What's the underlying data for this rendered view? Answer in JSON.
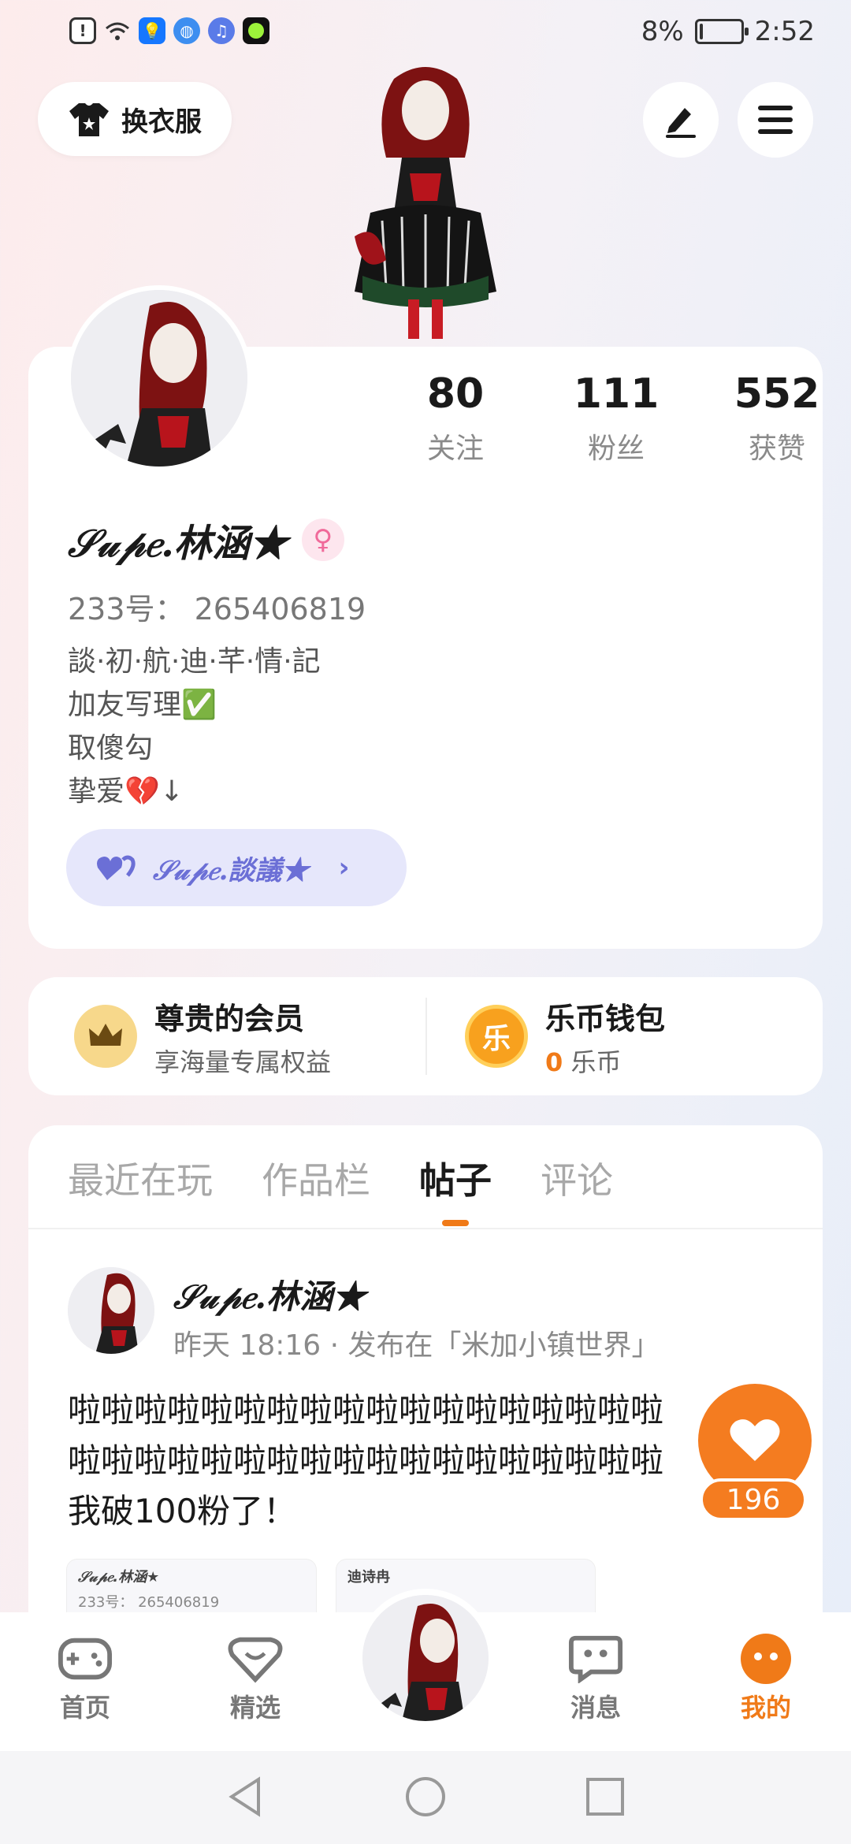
{
  "status_bar": {
    "battery": "8%",
    "battery_level": 0.08,
    "time": "2:52",
    "icons": [
      "alert-icon",
      "wifi-icon",
      "bulb-app-icon",
      "globe-app-icon",
      "music-app-icon",
      "green-app-icon"
    ]
  },
  "header": {
    "outfit_label": "换衣服",
    "edit_icon": "pen-icon",
    "menu_icon": "hamburger-icon"
  },
  "profile": {
    "stats": [
      {
        "value": "80",
        "label": "关注"
      },
      {
        "value": "111",
        "label": "粉丝"
      },
      {
        "value": "552",
        "label": "获赞"
      }
    ],
    "username": "𝒮𝓊𝓅𝑒.林涵★",
    "gender_symbol": "♀",
    "uid": "233号：  265406819",
    "bio": [
      "談·初·航·迪·芊·情·記",
      "加友写理✅",
      "取傻勾",
      "挚爱💔↓"
    ],
    "tag_label": "𝒮𝓊𝓅𝑒.談議★",
    "tag_chevron": "›"
  },
  "member": {
    "vip_title": "尊贵的会员",
    "vip_sub": "享海量专属权益",
    "wallet_title": "乐币钱包",
    "wallet_icon_text": "乐",
    "coin_value": "0",
    "coin_unit": "乐币"
  },
  "tabs": {
    "items": [
      "最近在玩",
      "作品栏",
      "帖子",
      "评论"
    ],
    "active_index": 2
  },
  "post": {
    "author": "𝒮𝓊𝓅𝑒.林涵★",
    "meta": "昨天 18:16 · 发布在「米加小镇世界」",
    "lines": [
      "啦啦啦啦啦啦啦啦啦啦啦啦啦啦啦啦啦啦",
      "啦啦啦啦啦啦啦啦啦啦啦啦啦啦啦啦啦啦",
      "我破100粉了！"
    ],
    "thumb1_name": "𝒮𝓊𝓅𝑒.林涵★",
    "thumb1_id": "233号：  265406819",
    "thumb2_name": "迪诗冉",
    "like_count": "196"
  },
  "bottom_nav": {
    "items": [
      {
        "label": "首页",
        "icon": "gamepad-icon"
      },
      {
        "label": "精选",
        "icon": "heart-chat-icon"
      },
      {
        "label": "消息",
        "icon": "message-icon"
      },
      {
        "label": "我的",
        "icon": "face-icon"
      }
    ],
    "active_index": 3
  },
  "colors": {
    "accent": "#f07a18",
    "tag_bg": "#e6e7fb",
    "tag_fg": "#6b6fd6",
    "gender_pink": "#f06a9a"
  }
}
